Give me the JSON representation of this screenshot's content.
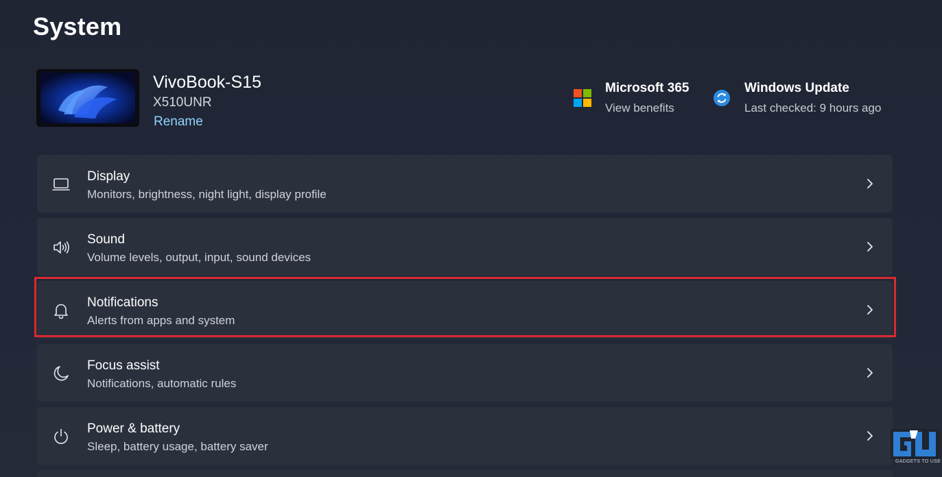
{
  "header": {
    "title": "System"
  },
  "device": {
    "name": "VivoBook-S15",
    "model": "X510UNR",
    "rename_label": "Rename"
  },
  "promos": [
    {
      "icon": "microsoft-logo-icon",
      "title": "Microsoft 365",
      "subtitle": "View benefits"
    },
    {
      "icon": "windows-update-icon",
      "title": "Windows Update",
      "subtitle": "Last checked: 9 hours ago"
    }
  ],
  "settings": [
    {
      "icon": "laptop-display-icon",
      "title": "Display",
      "description": "Monitors, brightness, night light, display profile"
    },
    {
      "icon": "speaker-icon",
      "title": "Sound",
      "description": "Volume levels, output, input, sound devices"
    },
    {
      "icon": "bell-icon",
      "title": "Notifications",
      "description": "Alerts from apps and system"
    },
    {
      "icon": "moon-icon",
      "title": "Focus assist",
      "description": "Notifications, automatic rules"
    },
    {
      "icon": "power-icon",
      "title": "Power & battery",
      "description": "Sleep, battery usage, battery saver"
    }
  ],
  "watermark": {
    "text": "GADGETS TO USE"
  },
  "colors": {
    "accent_link": "#8fd3ff",
    "highlight_border": "#d92a2f",
    "card_bg": "#2b303d"
  }
}
